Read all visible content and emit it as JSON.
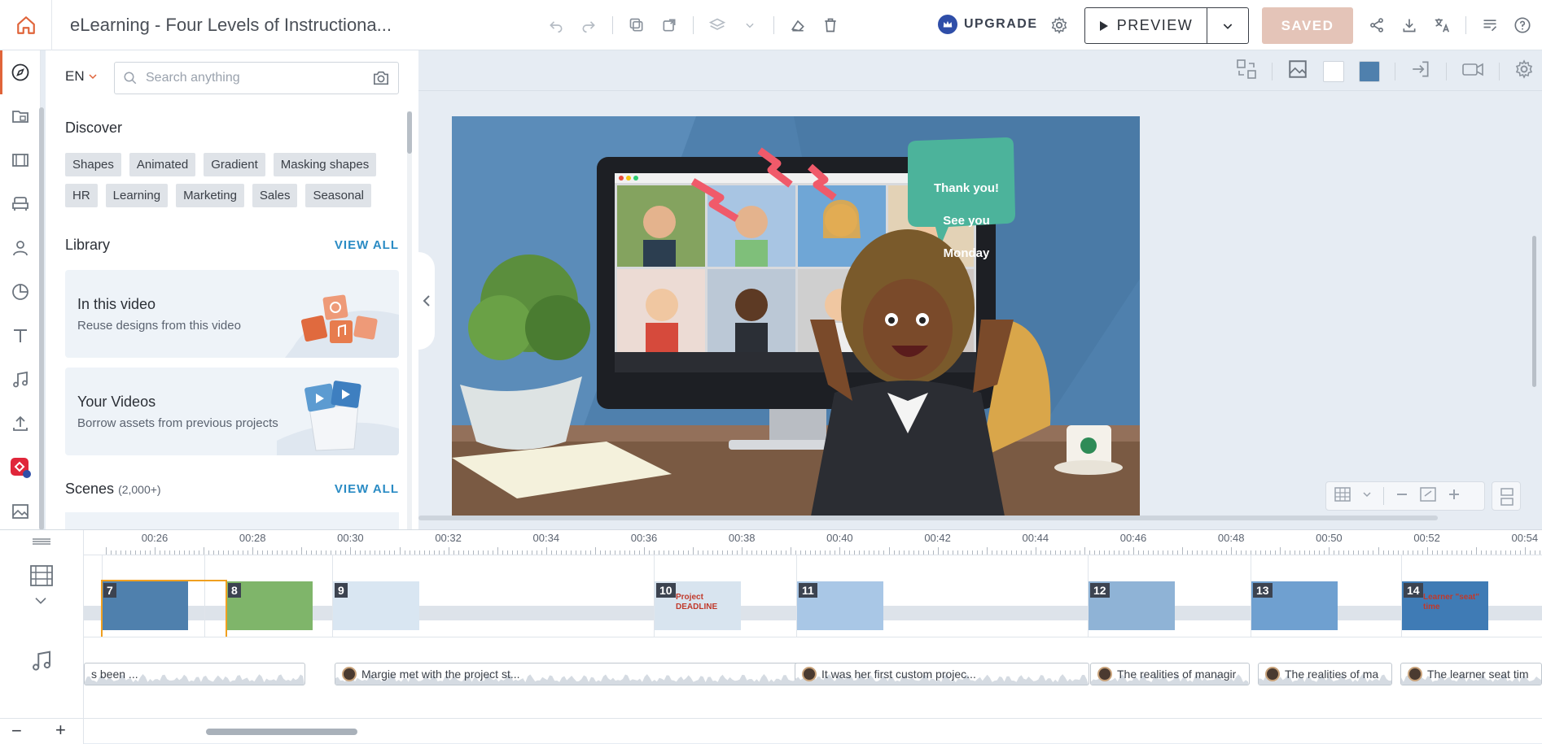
{
  "app": {
    "title": "eLearning - Four Levels of Instructiona...",
    "upgrade_label": "UPGRADE",
    "preview_label": "PREVIEW",
    "saved_label": "SAVED",
    "brand_color": "#e0643a",
    "accent_link_color": "#2a8bc4"
  },
  "toolbar": {
    "icons": [
      "undo-icon",
      "redo-icon",
      "copy-icon",
      "duplicate-icon",
      "layers-icon",
      "chevron-down-icon",
      "clear-icon",
      "delete-icon"
    ],
    "right_icons": [
      "share-icon",
      "download-icon",
      "translate-icon",
      "notes-icon",
      "help-icon"
    ]
  },
  "rail": {
    "items": [
      "explore-icon",
      "folder-icon",
      "media-icon",
      "furniture-icon",
      "character-icon",
      "chart-icon",
      "text-icon",
      "music-icon",
      "upload-icon",
      "brand-icon",
      "image-icon"
    ]
  },
  "panel": {
    "language": "EN",
    "search_placeholder": "Search anything",
    "discover_title": "Discover",
    "tags": [
      "Shapes",
      "Animated",
      "Gradient",
      "Masking shapes",
      "HR",
      "Learning",
      "Marketing",
      "Sales",
      "Seasonal"
    ],
    "library_title": "Library",
    "library_view_all": "VIEW ALL",
    "cards": [
      {
        "title": "In this video",
        "subtitle": "Reuse designs from this video"
      },
      {
        "title": "Your Videos",
        "subtitle": "Borrow assets from previous projects"
      }
    ],
    "scenes_title": "Scenes",
    "scenes_count": "(2,000+)",
    "scenes_view_all": "VIEW ALL"
  },
  "stage": {
    "speech_line1": "Thank you!",
    "speech_line2": "See you Monday",
    "swatch_colors": [
      "#ffffff",
      "#4f80ad"
    ]
  },
  "timeline": {
    "ticks": [
      "00:26",
      "00:28",
      "00:30",
      "00:32",
      "00:34",
      "00:36",
      "00:38",
      "00:40",
      "00:42",
      "00:44",
      "00:46",
      "00:48",
      "00:50",
      "00:52",
      "00:54"
    ],
    "scenes": [
      {
        "num": "7",
        "label": ""
      },
      {
        "num": "8",
        "label": ""
      },
      {
        "num": "9",
        "label": ""
      },
      {
        "num": "10",
        "label": "Project DEADLINE"
      },
      {
        "num": "11",
        "label": ""
      },
      {
        "num": "12",
        "label": ""
      },
      {
        "num": "13",
        "label": ""
      },
      {
        "num": "14",
        "label": "Learner \"seat\" time"
      }
    ],
    "audio_clips": [
      {
        "text": "s been ..."
      },
      {
        "text": "Margie met with the project st..."
      },
      {
        "text": "It was her first custom projec..."
      },
      {
        "text": "The realities of managir"
      },
      {
        "text": "The realities of ma"
      },
      {
        "text": "The learner seat tim"
      }
    ],
    "zoom_out": "−",
    "zoom_in": "+"
  }
}
